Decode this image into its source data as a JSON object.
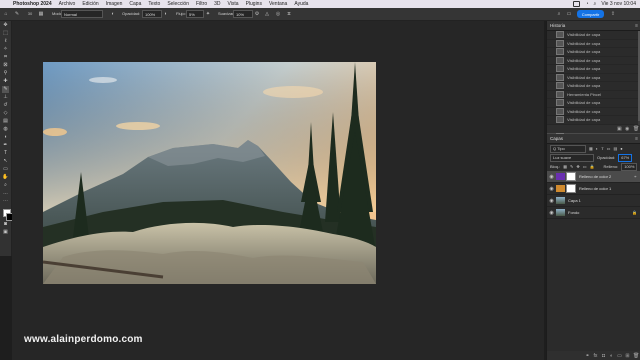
{
  "menubar": {
    "app_name": "Photoshop 2024",
    "items": [
      "Archivo",
      "Edición",
      "Imagen",
      "Capa",
      "Texto",
      "Selección",
      "Filtro",
      "3D",
      "Vista",
      "Plugins",
      "Ventana",
      "Ayuda"
    ],
    "clock": "Vie 3 nov 10:04"
  },
  "options": {
    "modo_label": "Modo:",
    "modo_value": "Normal",
    "opacidad_label": "Opacidad:",
    "opacidad_value": "100%",
    "flujo_label": "Flujo:",
    "flujo_value": "5%",
    "suavizar_label": "Suavizar:",
    "suavizar_value": "10%",
    "brush_size": "30",
    "share_label": "Compartir"
  },
  "history": {
    "title": "Historia",
    "rows": [
      "Visibilidad de capa",
      "Visibilidad de capa",
      "Visibilidad de capa",
      "Visibilidad de capa",
      "Visibilidad de capa",
      "Visibilidad de capa",
      "Visibilidad de capa",
      "Herramienta Pincel",
      "Visibilidad de capa",
      "Visibilidad de capa",
      "Visibilidad de capa",
      "Visibilidad de capa",
      "Cambio de la opacidad principal"
    ],
    "selected_index": 12
  },
  "layers": {
    "title": "Capas",
    "filter_label": "Q Tipo",
    "blend_mode": "Luz suave",
    "opacity_label": "Opacidad:",
    "opacity_value": "67%",
    "lock_label": "Bloq.:",
    "fill_label": "Relleno:",
    "fill_value": "100%",
    "items": [
      {
        "name": "Relleno de color 2",
        "kind": "fill-purple",
        "active": true
      },
      {
        "name": "Relleno de color 1",
        "kind": "fill-orange",
        "active": false
      },
      {
        "name": "Capa 1",
        "kind": "pixel",
        "active": false
      },
      {
        "name": "Fondo",
        "kind": "background",
        "active": false
      }
    ]
  },
  "watermark": "www.alainperdomo.com",
  "colors": {
    "accent": "#1473e6",
    "fill2": "#6a2fb0",
    "fill1": "#d08a2e"
  }
}
